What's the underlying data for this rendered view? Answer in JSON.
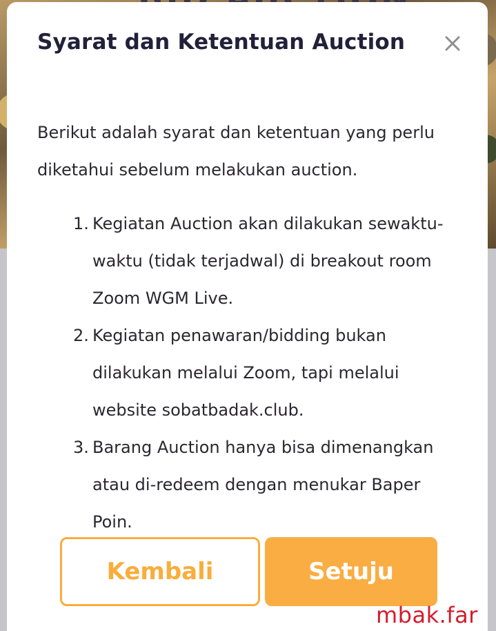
{
  "background": {
    "banner_title": "BID AUCTION"
  },
  "modal": {
    "title": "Syarat dan Ketentuan Auction",
    "close_icon": "close-icon",
    "intro": "Berikut adalah syarat dan ketentuan yang perlu diketahui sebelum melakukan auction.",
    "terms": [
      {
        "number": "1.",
        "lines": [
          "Kegiatan Auction akan dilakukan sewaktu-",
          "waktu (tidak terjadwal) di breakout room",
          "Zoom WGM Live."
        ]
      },
      {
        "number": "2.",
        "lines": [
          "Kegiatan penawaran/bidding bukan",
          "dilakukan melalui Zoom, tapi melalui",
          "website sobatbadak.club."
        ]
      },
      {
        "number": "3.",
        "lines": [
          "Barang Auction hanya bisa dimenangkan",
          "atau di-redeem dengan menukar Baper",
          "Poin."
        ]
      }
    ],
    "back_label": "Kembali",
    "agree_label": "Setuju"
  },
  "colors": {
    "accent": "#faad42",
    "title_text": "#23203a",
    "watermark": "#d21d2c"
  },
  "watermark": "mbak.far"
}
